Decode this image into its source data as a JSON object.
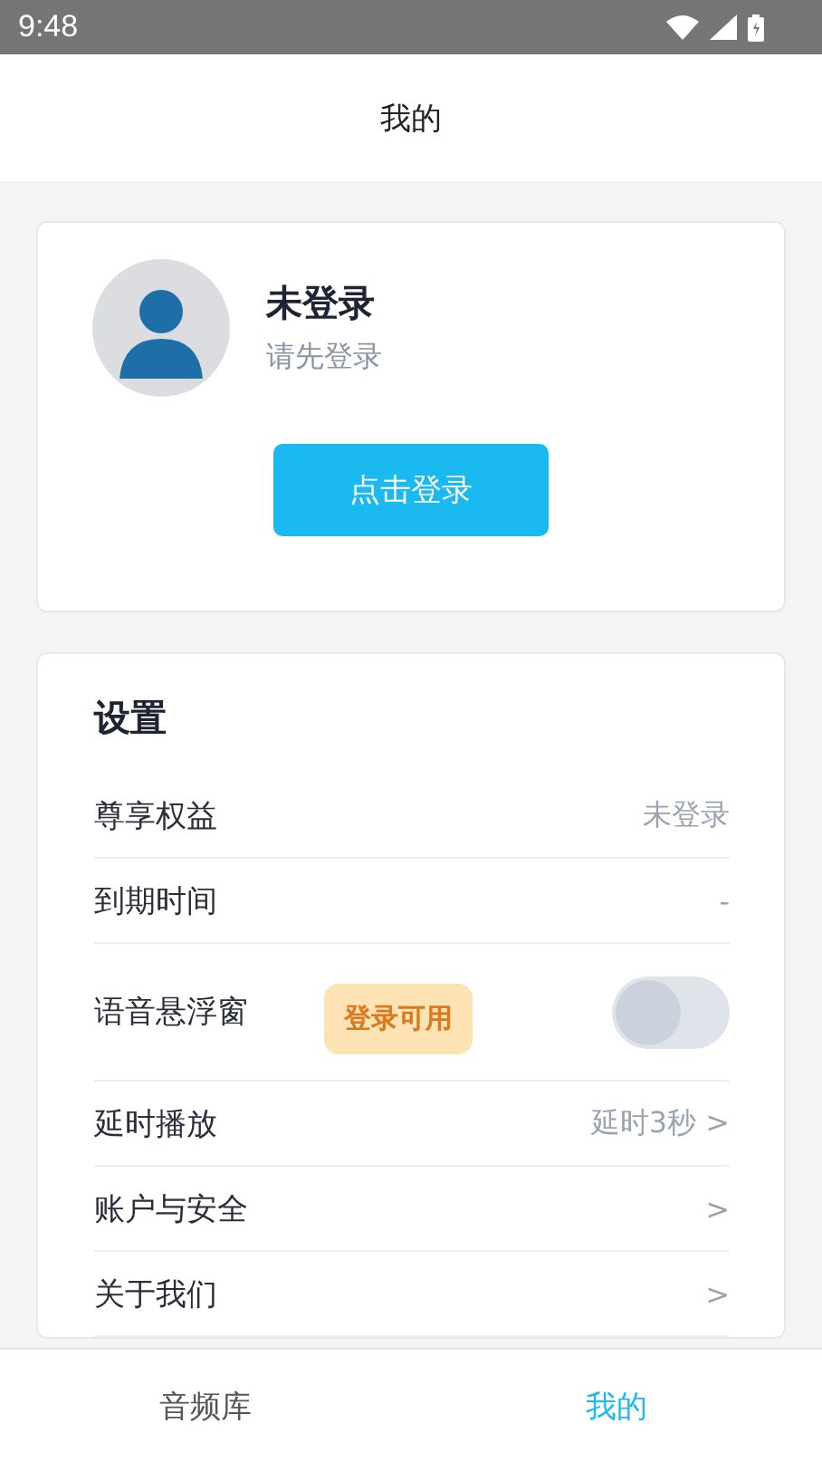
{
  "status_bar": {
    "time": "9:48"
  },
  "header": {
    "title": "我的"
  },
  "profile": {
    "name": "未登录",
    "subtitle": "请先登录",
    "login_button": "点击登录"
  },
  "settings": {
    "title": "设置",
    "rows": [
      {
        "kind": "value",
        "label": "尊享权益",
        "value": "未登录"
      },
      {
        "kind": "value",
        "label": "到期时间",
        "value": "-"
      },
      {
        "kind": "toggle",
        "label": "语音悬浮窗",
        "badge": "登录可用",
        "on": false
      },
      {
        "kind": "value",
        "label": "延时播放",
        "value": "延时3秒 >"
      },
      {
        "kind": "value",
        "label": "账户与安全",
        "value": ">"
      },
      {
        "kind": "value",
        "label": "关于我们",
        "value": ">"
      }
    ]
  },
  "bottom_nav": [
    {
      "label": "音频库",
      "selected": false
    },
    {
      "label": "我的",
      "selected": true
    }
  ]
}
